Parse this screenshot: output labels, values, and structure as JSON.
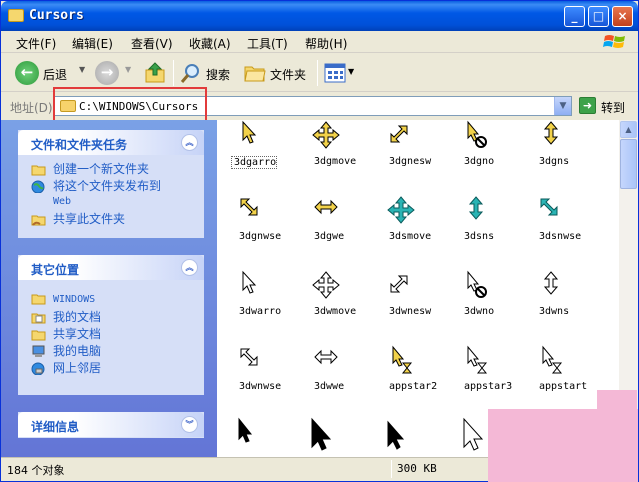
{
  "window": {
    "title": "Cursors"
  },
  "menu": [
    "文件(F)",
    "编辑(E)",
    "查看(V)",
    "收藏(A)",
    "工具(T)",
    "帮助(H)"
  ],
  "toolbar": {
    "back": "后退",
    "search": "搜索",
    "folders": "文件夹"
  },
  "address": {
    "label": "地址(D)",
    "path": "C:\\WINDOWS\\Cursors",
    "go": "转到"
  },
  "tasks_panel": {
    "title": "文件和文件夹任务",
    "items": [
      "创建一个新文件夹",
      "将这个文件夹发布到",
      "Web",
      "共享此文件夹"
    ]
  },
  "places_panel": {
    "title": "其它位置",
    "items": [
      "WINDOWS",
      "我的文档",
      "共享文档",
      "我的电脑",
      "网上邻居"
    ]
  },
  "details_panel": {
    "title": "详细信息"
  },
  "files": [
    "3dgarro",
    "3dgmove",
    "3dgnesw",
    "3dgno",
    "3dgns",
    "3dgnwse",
    "3dgwe",
    "3dsmove",
    "3dsns",
    "3dsnwse",
    "3dwarro",
    "3dwmove",
    "3dwnesw",
    "3dwno",
    "3dwns",
    "3dwnwse",
    "3dwwe",
    "appstar2",
    "appstar3",
    "appstart"
  ],
  "status": {
    "count": "184 个对象",
    "size": "300 KB"
  },
  "colors": {
    "accent_title": "#0054e3",
    "task_blue": "#215dc6",
    "highlight_red": "#e23b3b"
  }
}
